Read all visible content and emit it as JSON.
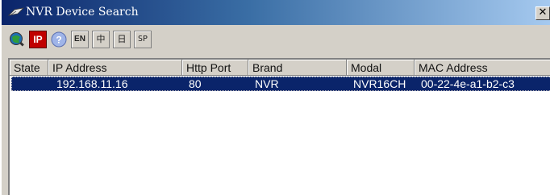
{
  "window": {
    "title": "NVR Device Search",
    "close_label": "✕"
  },
  "toolbar": {
    "buttons": [
      {
        "name": "search",
        "icon": "search-icon"
      },
      {
        "name": "ip",
        "label": "IP",
        "icon": "ip-icon"
      },
      {
        "name": "help",
        "icon": "help-icon"
      },
      {
        "name": "lang-en",
        "label": "EN"
      },
      {
        "name": "lang-cn",
        "label": "中"
      },
      {
        "name": "lang-jp",
        "label": "日"
      },
      {
        "name": "lang-sp",
        "label": "SP"
      }
    ]
  },
  "table": {
    "columns": [
      "State",
      "IP Address",
      "Http Port",
      "Brand",
      "Modal",
      "MAC Address"
    ],
    "rows": [
      {
        "state": "",
        "ip": "192.168.11.16",
        "port": "80",
        "brand": "NVR",
        "modal": "NVR16CH",
        "mac": "00-22-4e-a1-b2-c3"
      }
    ]
  },
  "colors": {
    "titlebar_start": "#0a246a",
    "titlebar_end": "#a6caf0",
    "selection": "#0a246a",
    "face": "#d4d0c8"
  }
}
